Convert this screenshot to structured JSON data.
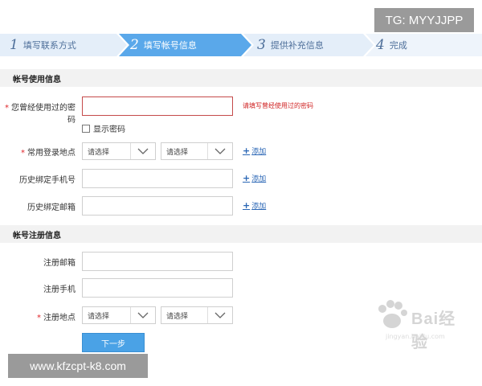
{
  "watermarks": {
    "tg": "TG: MYYJJPP",
    "url": "www.kfzcpt-k8.com",
    "baidu_logo": "Bai",
    "baidu_cn": "经验",
    "baidu_sub": "jingyan.baidu.com"
  },
  "steps": [
    {
      "num": "1",
      "label": "填写联系方式",
      "active": false
    },
    {
      "num": "2",
      "label": "填写帐号信息",
      "active": true
    },
    {
      "num": "3",
      "label": "提供补充信息",
      "active": false
    },
    {
      "num": "4",
      "label": "完成",
      "active": false
    }
  ],
  "sections": {
    "usage": "帐号使用信息",
    "registration": "帐号注册信息"
  },
  "form": {
    "used_password_label": "您曾经使用过的密码",
    "used_password_value": "",
    "used_password_error": "请填写曾经使用过的密码",
    "show_password_label": "显示密码",
    "login_location_label": "常用登录地点",
    "select_placeholder": "请选择",
    "add_label": "添加",
    "bound_phone_label": "历史绑定手机号",
    "bound_phone_value": "",
    "bound_email_label": "历史绑定邮箱",
    "bound_email_value": "",
    "reg_email_label": "注册邮箱",
    "reg_email_value": "",
    "reg_phone_label": "注册手机",
    "reg_phone_value": "",
    "reg_location_label": "注册地点",
    "next_button": "下一步"
  },
  "colors": {
    "step_active": "#5aa8ea",
    "step_inactive": "#e4eef9",
    "error": "#d02424",
    "link": "#2a66b5",
    "button": "#4aa2e6"
  }
}
